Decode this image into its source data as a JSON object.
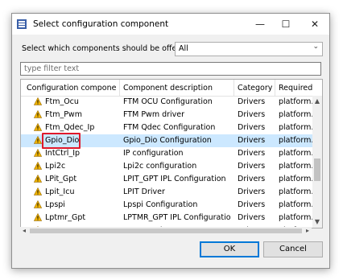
{
  "dialog": {
    "title": "Select configuration component",
    "minimize_glyph": "—",
    "maximize_glyph": "☐",
    "close_glyph": "✕"
  },
  "selector": {
    "label": "Select which components should be offered",
    "value": "All",
    "arrow": "⌄"
  },
  "filter": {
    "placeholder": "type filter text"
  },
  "table": {
    "headers": [
      "Configuration component",
      "Component description",
      "Category",
      "Required S"
    ],
    "rows": [
      [
        "Ftm_Ocu",
        "FTM OCU Configuration",
        "Drivers",
        "platform.d"
      ],
      [
        "Ftm_Pwm",
        "FTM Pwm driver",
        "Drivers",
        "platform.d"
      ],
      [
        "Ftm_Qdec_Ip",
        "FTM Qdec Configuration",
        "Drivers",
        "platform.d"
      ],
      [
        "Gpio_Dio",
        "Gpio_Dio Configuration",
        "Drivers",
        "platform.d"
      ],
      [
        "IntCtrl_Ip",
        "IP configuration",
        "Drivers",
        "platform.d"
      ],
      [
        "Lpi2c",
        "Lpi2c configuration",
        "Drivers",
        "platform.d"
      ],
      [
        "LPit_Gpt",
        "LPIT_GPT IPL Configuration",
        "Drivers",
        "platform.d"
      ],
      [
        "Lpit_Icu",
        "LPIT Driver",
        "Drivers",
        "platform.d"
      ],
      [
        "Lpspi",
        "Lpspi Configuration",
        "Drivers",
        "platform.d"
      ],
      [
        "Lptmr_Gpt",
        "LPTMR_GPT IPL Configuration",
        "Drivers",
        "platform.d"
      ],
      [
        "Lptmr_Icu",
        "LPTMR Driver",
        "Drivers",
        "platform.d"
      ]
    ],
    "selected_index": 3,
    "highlighted_index": 3
  },
  "buttons": {
    "ok": "OK",
    "cancel": "Cancel"
  },
  "colors": {
    "selection": "#cce8ff",
    "highlight": "#e0192b",
    "warning": "#f0b400"
  },
  "icons": {
    "app": "app-icon",
    "row": "warning-icon"
  }
}
